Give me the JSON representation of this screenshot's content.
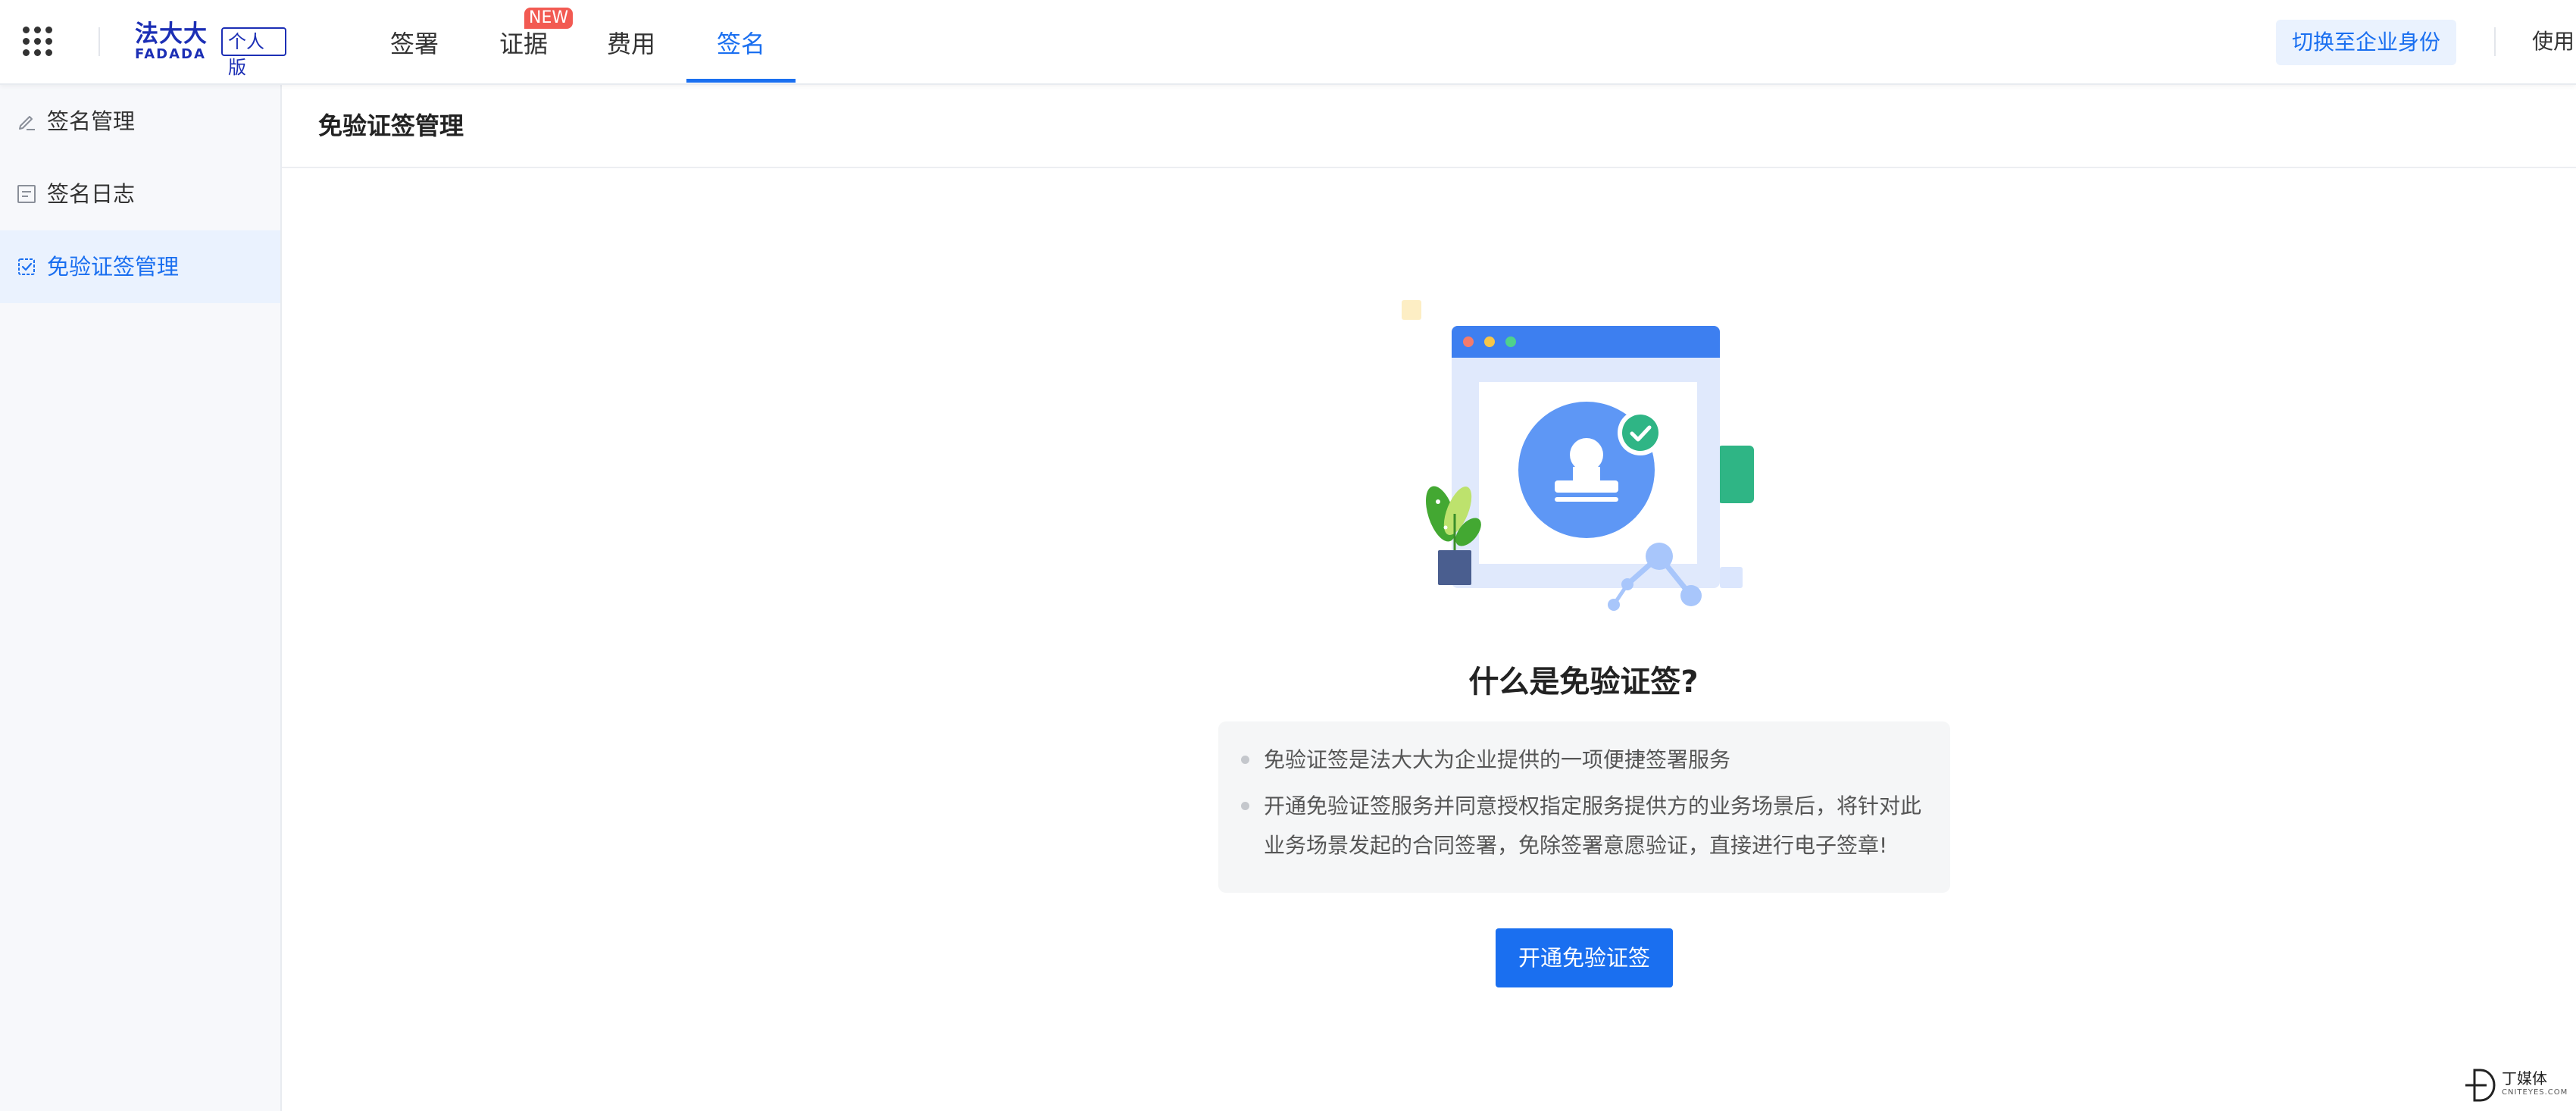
{
  "app": {
    "brand_cn": "法大大",
    "brand_en": "FADADA",
    "edition": "个人版",
    "menu_icon": "apps-grid-icon"
  },
  "nav": {
    "tabs": [
      {
        "label": "签署"
      },
      {
        "label": "证据",
        "badge": "NEW"
      },
      {
        "label": "费用"
      },
      {
        "label": "签名",
        "active": true
      }
    ],
    "switch_identity": "切换至企业身份",
    "use_link": "使用"
  },
  "sidebar": {
    "items": [
      {
        "label": "签名管理",
        "icon": "pen-edit-icon"
      },
      {
        "label": "签名日志",
        "icon": "log-list-icon"
      },
      {
        "label": "免验证签管理",
        "icon": "seal-check-icon",
        "active": true
      }
    ]
  },
  "main": {
    "page_title": "免验证签管理",
    "question": "什么是免验证签?",
    "bullets": [
      "免验证签是法大大为企业提供的一项便捷签署服务",
      "开通免验证签服务并同意授权指定服务提供方的业务场景后，将针对此",
      "业务场景发起的合同签署，免除签署意愿验证，直接进行电子签章!"
    ],
    "cta": "开通免验证签"
  },
  "watermark": {
    "cn": "丁媒体",
    "en": "CNITEYES.COM"
  },
  "colors": {
    "primary": "#1a6ff0",
    "brand": "#1c2fb5",
    "badge": "#f25a52",
    "sidebar_active_bg": "#eaf2fe"
  }
}
